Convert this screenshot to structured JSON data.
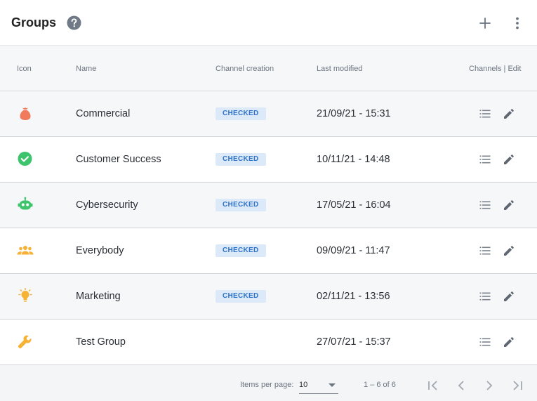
{
  "header": {
    "title": "Groups"
  },
  "table": {
    "columns": {
      "icon": "Icon",
      "name": "Name",
      "channel_creation": "Channel creation",
      "last_modified": "Last modified",
      "actions": "Channels | Edit"
    },
    "rows": [
      {
        "icon": "money-bag-icon",
        "icon_color": "#f07a5b",
        "name": "Commercial",
        "channel_creation": "CHECKED",
        "last_modified": "21/09/21 - 15:31"
      },
      {
        "icon": "check-circle-icon",
        "icon_color": "#3ec46d",
        "name": "Customer Success",
        "channel_creation": "CHECKED",
        "last_modified": "10/11/21 - 14:48"
      },
      {
        "icon": "robot-icon",
        "icon_color": "#3ec46d",
        "name": "Cybersecurity",
        "channel_creation": "CHECKED",
        "last_modified": "17/05/21 - 16:04"
      },
      {
        "icon": "people-group-icon",
        "icon_color": "#f5b234",
        "name": "Everybody",
        "channel_creation": "CHECKED",
        "last_modified": "09/09/21 - 11:47"
      },
      {
        "icon": "lightbulb-icon",
        "icon_color": "#f5b234",
        "name": "Marketing",
        "channel_creation": "CHECKED",
        "last_modified": "02/11/21 - 13:56"
      },
      {
        "icon": "wrench-icon",
        "icon_color": "#f5b234",
        "name": "Test Group",
        "channel_creation": "",
        "last_modified": "27/07/21 - 15:37"
      }
    ]
  },
  "pagination": {
    "items_per_page_label": "Items per page:",
    "items_per_page": "10",
    "range": "1 – 6 of 6"
  },
  "colors": {
    "badge_bg": "#dbe9f9",
    "badge_text": "#2e73c8",
    "icon_gray": "#6b7480"
  }
}
